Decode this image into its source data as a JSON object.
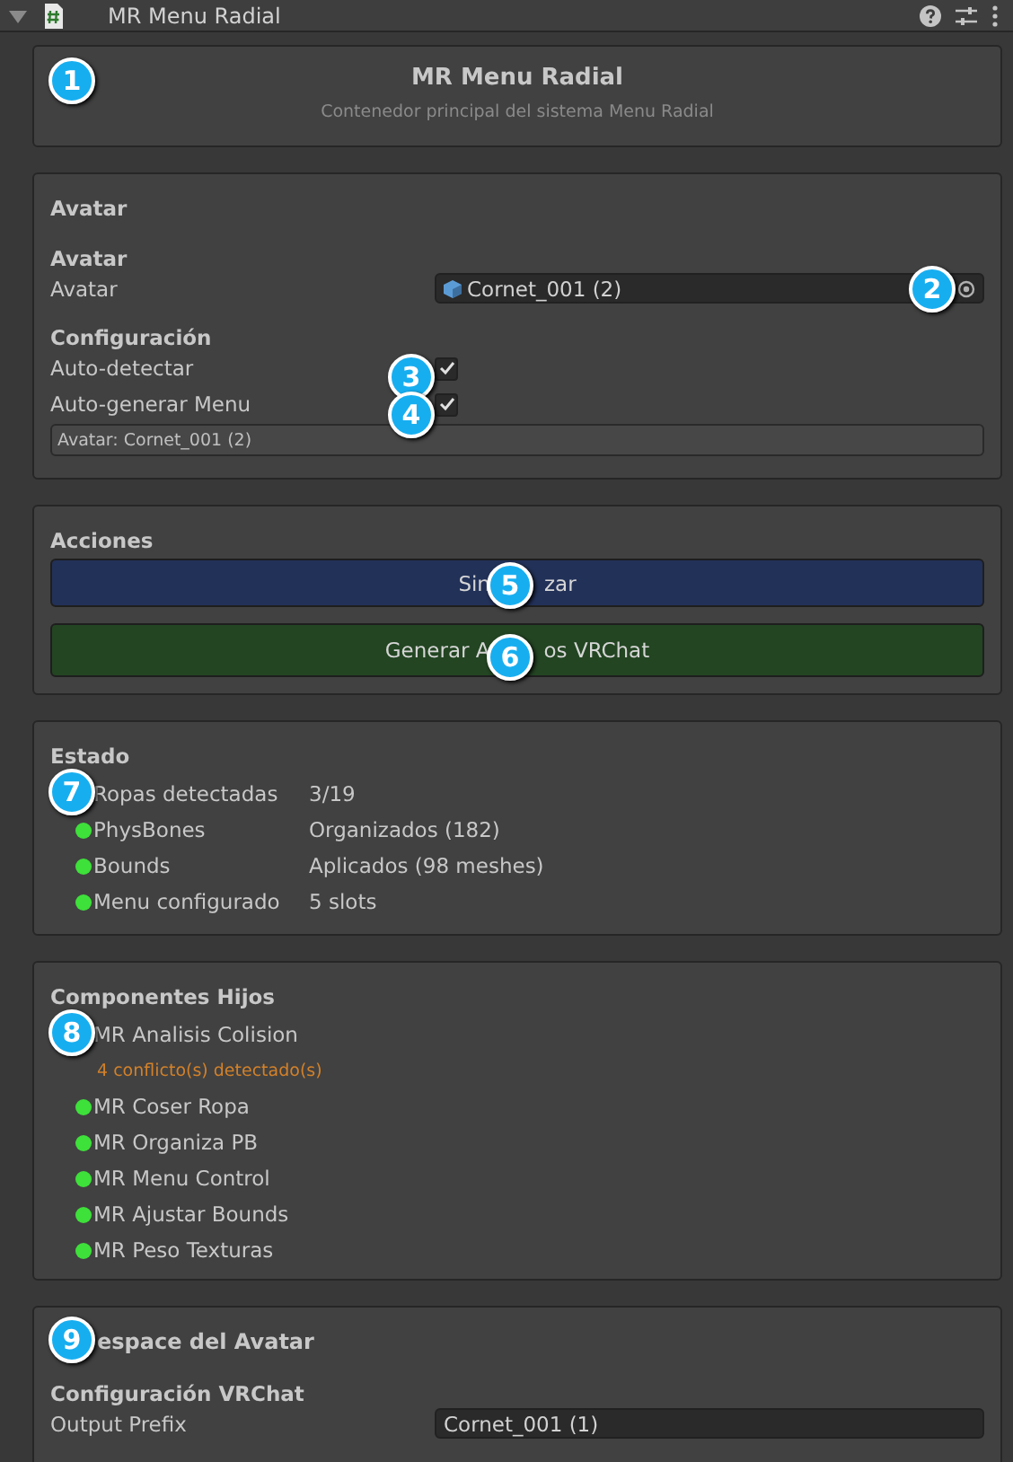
{
  "window": {
    "title": "MR Menu Radial",
    "expanded": true
  },
  "header": {
    "title": "MR Menu Radial",
    "subtitle": "Contenedor principal del sistema Menu Radial"
  },
  "avatar_section": {
    "title": "Avatar",
    "group_title": "Avatar",
    "avatar_label": "Avatar",
    "avatar_value": "Cornet_001 (2)",
    "config_title": "Configuración",
    "toggles": [
      {
        "label": "Auto-detectar",
        "checked": true
      },
      {
        "label": "Auto-generar Menu",
        "checked": true
      }
    ],
    "info": "Avatar: Cornet_001 (2)"
  },
  "actions": {
    "title": "Acciones",
    "buttons": [
      {
        "label_parts": [
          "Sin",
          "zar"
        ],
        "kind": "primary"
      },
      {
        "label_parts": [
          "Generar A",
          "os VRChat"
        ],
        "kind": "success"
      }
    ]
  },
  "status": {
    "title": "Estado",
    "rows": [
      {
        "label": "Ropas detectadas",
        "value": "3/19"
      },
      {
        "label": "PhysBones",
        "value": "Organizados (182)",
        "color": "#3ee03a"
      },
      {
        "label": "Bounds",
        "value": "Aplicados (98 meshes)",
        "color": "#3ee03a"
      },
      {
        "label": "Menu configurado",
        "value": "5 slots",
        "color": "#3ee03a"
      }
    ]
  },
  "children_section": {
    "title": "Componentes Hijos",
    "items": [
      {
        "name": "MR Analisis Colision",
        "note": "4 conflicto(s) detectado(s)"
      },
      {
        "name": "MR Coser Ropa",
        "color": "#3ee03a"
      },
      {
        "name": "MR Organiza PB",
        "color": "#3ee03a"
      },
      {
        "name": "MR Menu Control",
        "color": "#3ee03a"
      },
      {
        "name": "MR Ajustar Bounds",
        "color": "#3ee03a"
      },
      {
        "name": "MR Peso Texturas",
        "color": "#3ee03a"
      }
    ]
  },
  "vrchat_section": {
    "title": "espace del Avatar",
    "group_title": "Configuración VRChat",
    "field_label": "Output Prefix",
    "field_value": "Cornet_001 (1)"
  },
  "callouts": [
    "1",
    "2",
    "3",
    "4",
    "5",
    "6",
    "7",
    "8",
    "9"
  ]
}
